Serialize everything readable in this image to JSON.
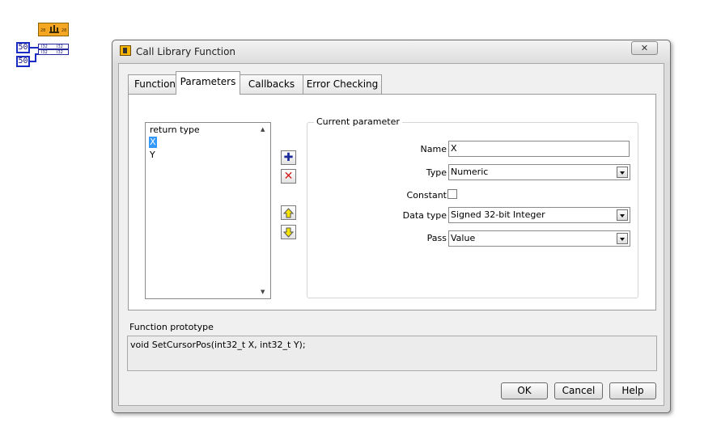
{
  "block_node": {
    "header_labels": [
      "28",
      "28"
    ],
    "terminal_labels": [
      "I32",
      "I32",
      "I32",
      "I32"
    ],
    "constants": [
      "50",
      "50"
    ]
  },
  "dialog": {
    "title": "Call Library Function",
    "close_label": "✕",
    "tabs": [
      "Function",
      "Parameters",
      "Callbacks",
      "Error Checking"
    ],
    "active_tab": "Parameters",
    "param_list": [
      "return type",
      "X",
      "Y"
    ],
    "selected_param": "X",
    "current_parameter": {
      "group_title": "Current parameter",
      "name_label": "Name",
      "name_value": "X",
      "type_label": "Type",
      "type_value": "Numeric",
      "constant_label": "Constant",
      "data_type_label": "Data type",
      "data_type_value": "Signed 32-bit Integer",
      "pass_label": "Pass",
      "pass_value": "Value"
    },
    "prototype_label": "Function prototype",
    "prototype_text": "void  SetCursorPos(int32_t X, int32_t Y);",
    "buttons": {
      "ok": "OK",
      "cancel": "Cancel",
      "help": "Help"
    }
  },
  "colors": {
    "selection": "#3399ff",
    "node_orange": "#f5a623",
    "wire_blue": "#1a2cc4"
  }
}
